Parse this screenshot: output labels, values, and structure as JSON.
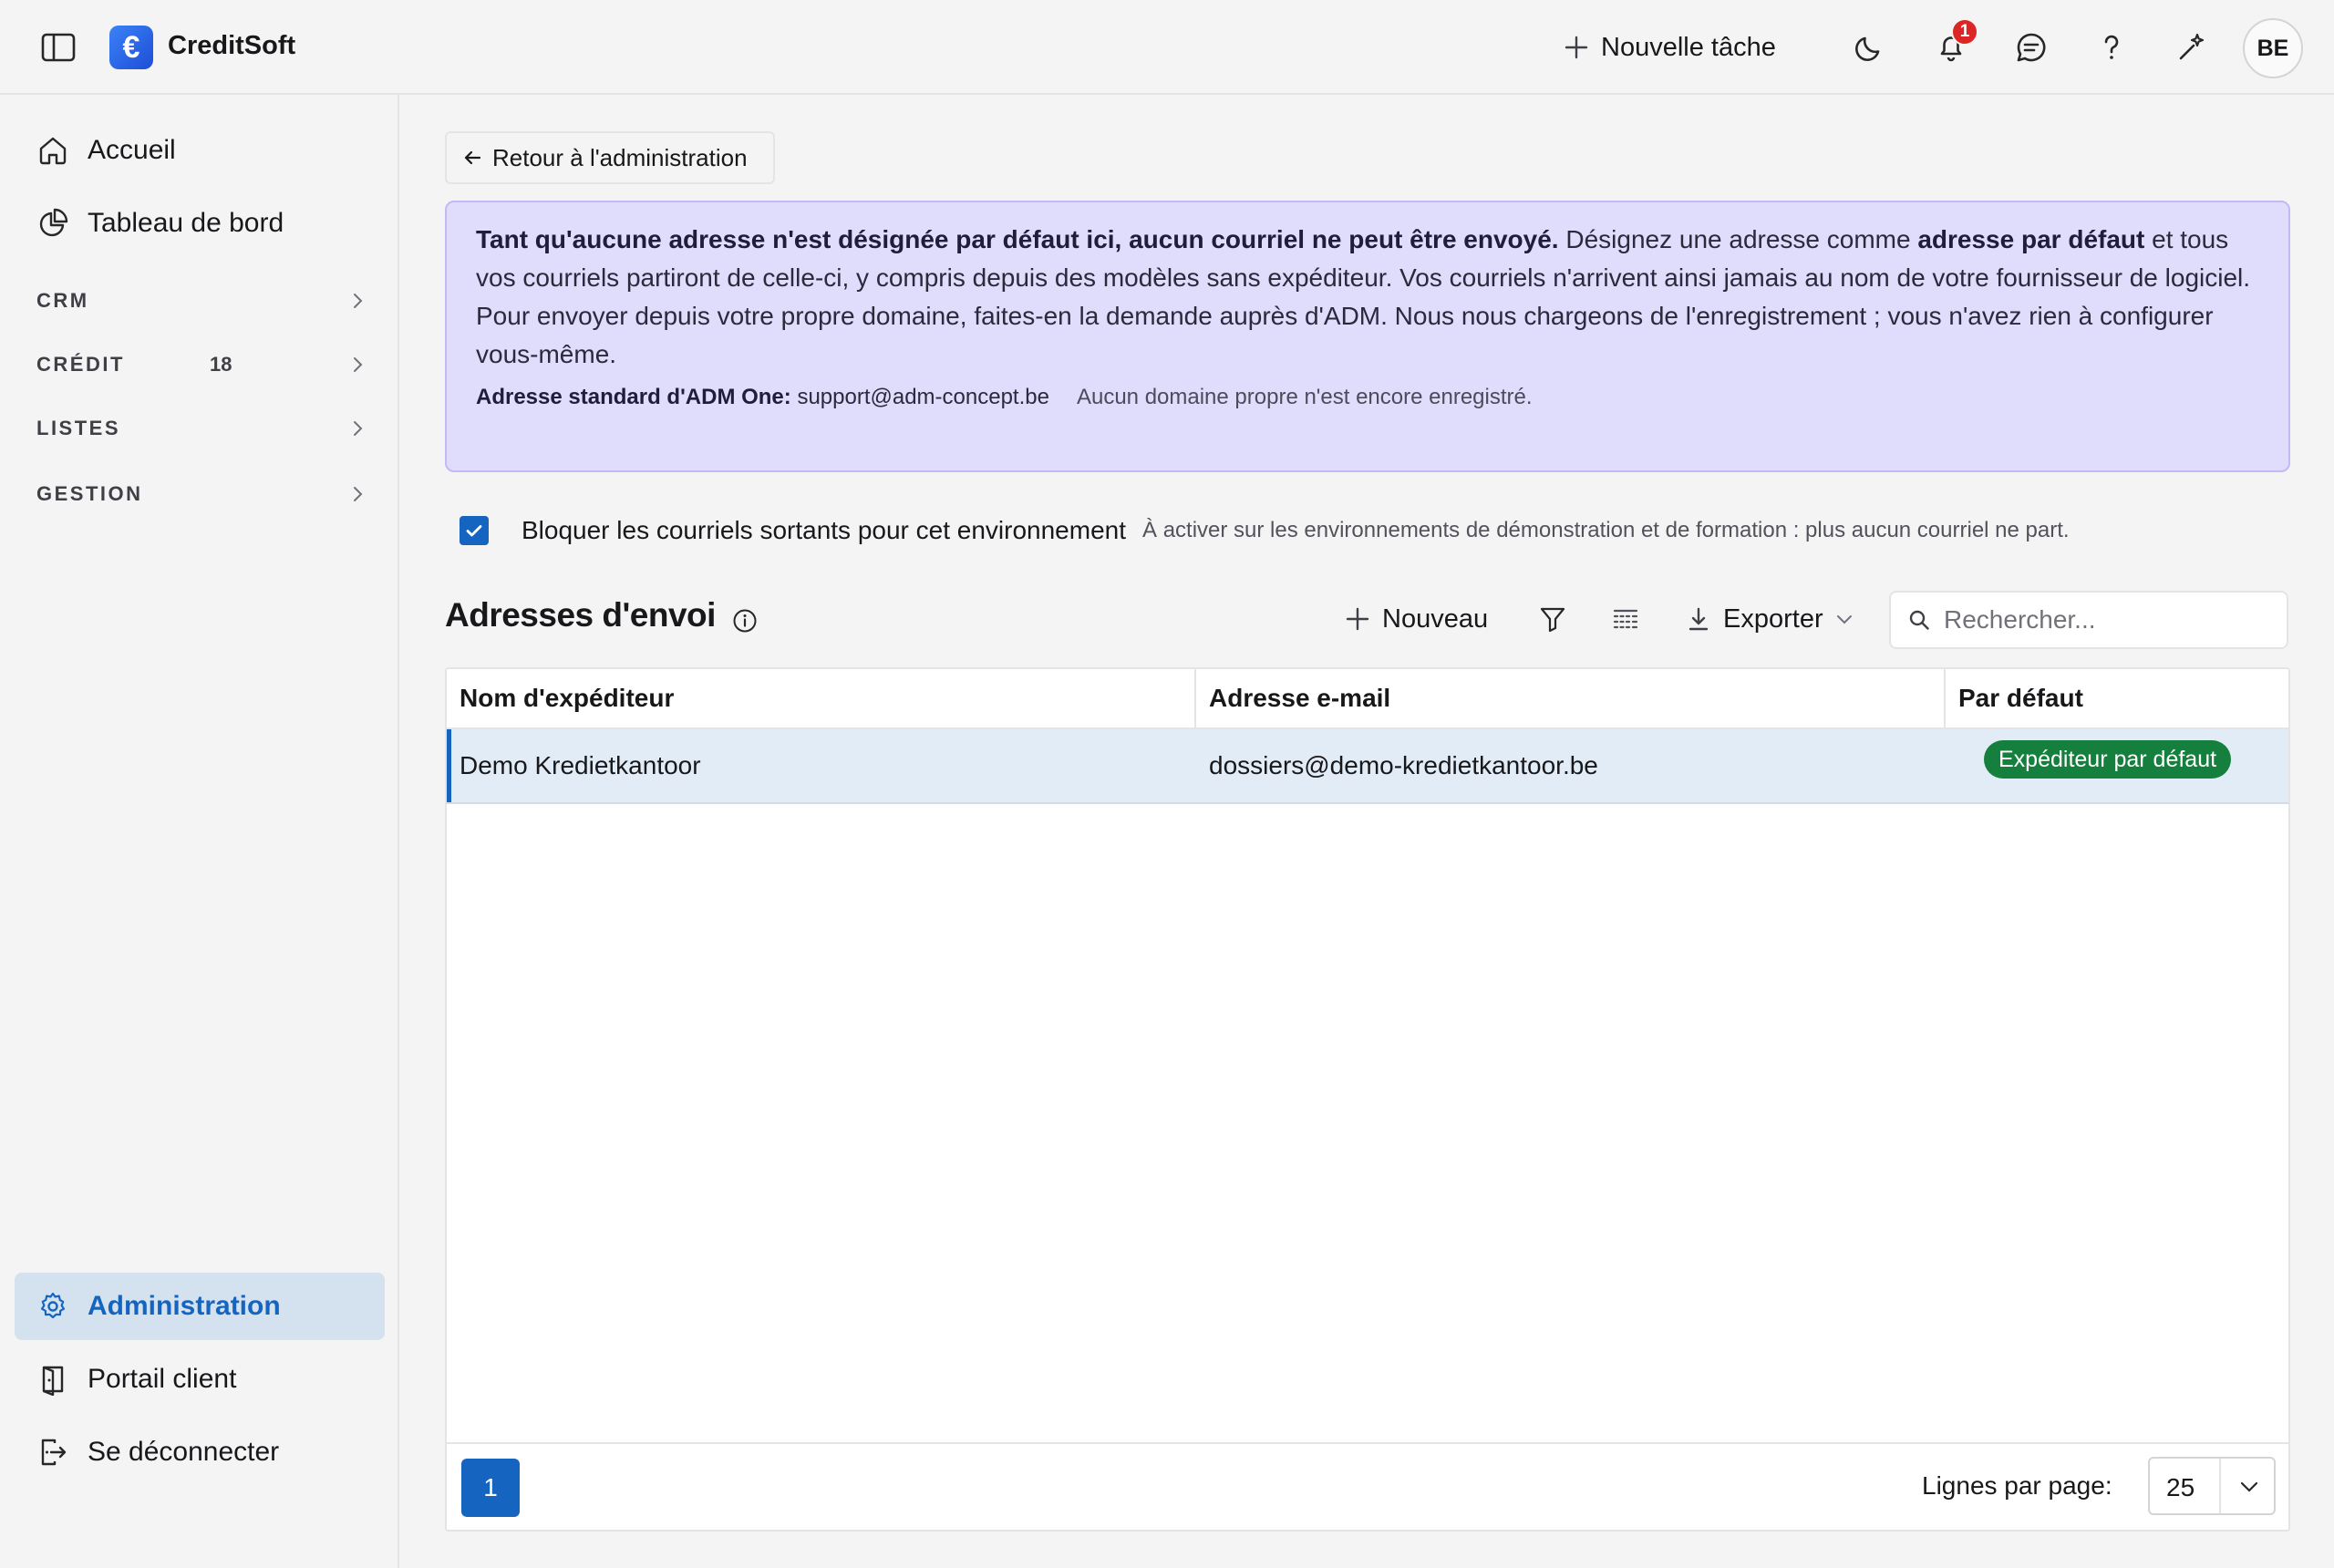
{
  "app": {
    "name": "CreditSoft",
    "logo_glyph": "€",
    "accent_color": "#1565c0"
  },
  "topbar": {
    "new_task_label": "Nouvelle tâche",
    "notification_count": "1",
    "avatar_initials": "BE",
    "icons": [
      "sidebar-toggle-icon",
      "plus-icon",
      "moon-icon",
      "bell-icon",
      "chat-icon",
      "help-icon",
      "sparkle-icon"
    ]
  },
  "sidebar": {
    "top_items": [
      {
        "label": "Accueil",
        "icon": "home-icon"
      },
      {
        "label": "Tableau de bord",
        "icon": "pie-chart-icon"
      }
    ],
    "sections": [
      {
        "label": "CRM",
        "count": ""
      },
      {
        "label": "CRÉDIT",
        "count": "18"
      },
      {
        "label": "LISTES",
        "count": ""
      },
      {
        "label": "GESTION",
        "count": ""
      }
    ],
    "bottom_items": [
      {
        "label": "Administration",
        "icon": "gear-icon",
        "active": true
      },
      {
        "label": "Portail client",
        "icon": "portal-icon",
        "active": false
      },
      {
        "label": "Se déconnecter",
        "icon": "logout-icon",
        "active": false
      }
    ]
  },
  "main": {
    "back_label": "Retour à l'administration",
    "banner": {
      "bold_intro": "Tant qu'aucune adresse n'est désignée par défaut ici, aucun courriel ne peut être envoyé.",
      "text_1": " Désignez une adresse comme ",
      "bold_2": "adresse par défaut",
      "text_2": " et tous vos courriels partiront de celle-ci, y compris depuis des modèles sans expéditeur. Vos courriels n'arrivent ainsi jamais au nom de votre fournisseur de logiciel.",
      "para_2": "Pour envoyer depuis votre propre domaine, faites-en la demande auprès d'ADM. Nous nous chargeons de l'enregistrement ; vous n'avez rien à configurer vous-même.",
      "standard_label": "Adresse standard d'ADM One:",
      "standard_value": " support@adm-concept.be",
      "domain_note": "Aucun domaine propre n'est encore enregistré."
    },
    "block_outgoing": {
      "checked": true,
      "label": "Bloquer les courriels sortants pour cet environnement",
      "hint": "À activer sur les environnements de démonstration et de formation : plus aucun courriel ne part."
    },
    "section_title": "Adresses d'envoi",
    "toolbar": {
      "new_label": "Nouveau",
      "export_label": "Exporter",
      "search_placeholder": "Rechercher..."
    },
    "table": {
      "columns": [
        "Nom d'expéditeur",
        "Adresse e-mail",
        "Par défaut"
      ],
      "rows": [
        {
          "name": "Demo Kredietkantoor",
          "email": "dossiers@demo-kredietkantoor.be",
          "default_badge": "Expéditeur par défaut"
        }
      ]
    },
    "pagination": {
      "current_page": "1",
      "rows_per_page_label": "Lignes par page:",
      "rows_per_page_value": "25"
    }
  },
  "colors": {
    "banner_bg": "#e0dcfb",
    "default_badge": "#15803d",
    "active_nav_bg": "#d4e2f0"
  }
}
